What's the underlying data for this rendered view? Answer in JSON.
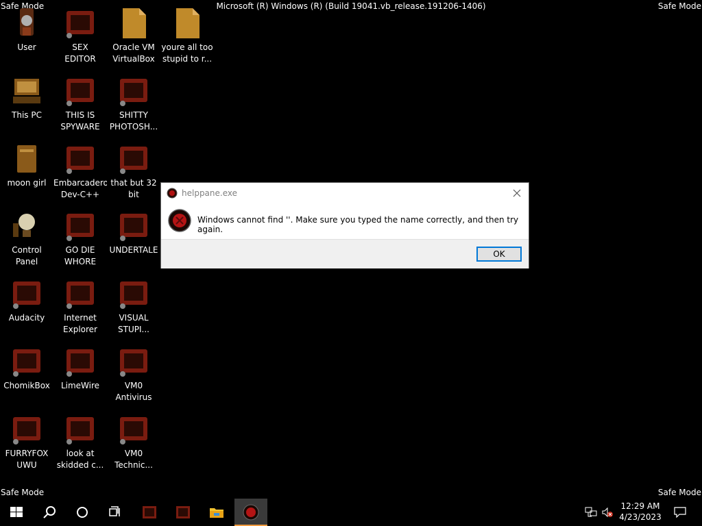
{
  "overlay": {
    "safe_mode_label": "Safe Mode",
    "build_string": "Microsoft (R) Windows (R) (Build 19041.vb_release.191206-1406)"
  },
  "desktop": {
    "icons": [
      {
        "label": "User",
        "icon": "user-folder-icon"
      },
      {
        "label": "SEX\nEDITOR",
        "icon": "program-icon"
      },
      {
        "label": "Oracle VM\nVirtualBox",
        "icon": "document-icon"
      },
      {
        "label": "youre all too\nstupid to r...",
        "icon": "document-icon"
      },
      {
        "label": "This PC",
        "icon": "computer-icon"
      },
      {
        "label": "THIS IS\nSPYWARE",
        "icon": "program-icon"
      },
      {
        "label": "SHITTY\nPHOTOSH...",
        "icon": "program-icon"
      },
      {
        "label": "moon girl",
        "icon": "trash-icon"
      },
      {
        "label": "Embarcadero\nDev-C++",
        "icon": "program-icon"
      },
      {
        "label": "that but 32\nbit",
        "icon": "program-icon"
      },
      {
        "label": "Control Panel",
        "icon": "lightbulb-icon"
      },
      {
        "label": "GO DIE\nWHORE",
        "icon": "program-icon"
      },
      {
        "label": "UNDERTALE",
        "icon": "program-icon"
      },
      {
        "label": "Audacity",
        "icon": "program-icon"
      },
      {
        "label": "Internet\nExplorer",
        "icon": "program-icon"
      },
      {
        "label": "VISUAL\nSTUPI...",
        "icon": "program-icon"
      },
      {
        "label": "ChomikBox",
        "icon": "program-icon"
      },
      {
        "label": "LimeWire",
        "icon": "program-icon"
      },
      {
        "label": "VM0\nAntivirus",
        "icon": "program-icon"
      },
      {
        "label": "FURRYFOX\nUWU",
        "icon": "program-icon"
      },
      {
        "label": "look at\nskidded c...",
        "icon": "program-icon"
      },
      {
        "label": "VM0\nTechnic...",
        "icon": "program-icon"
      }
    ]
  },
  "dialog": {
    "title": "helppane.exe",
    "message": "Windows cannot find ''. Make sure you typed the name correctly, and then try again.",
    "ok_label": "OK",
    "icon": "error-icon"
  },
  "taskbar": {
    "time": "12:29 AM",
    "date": "4/23/2023",
    "icons": [
      "start-icon",
      "search-icon",
      "cortana-icon",
      "task-view-icon",
      "program-icon",
      "program-icon",
      "file-explorer-icon",
      "error-app-icon"
    ],
    "colors": {
      "accent": "#f29a3e",
      "active_bg": "#3a3a3a"
    }
  }
}
